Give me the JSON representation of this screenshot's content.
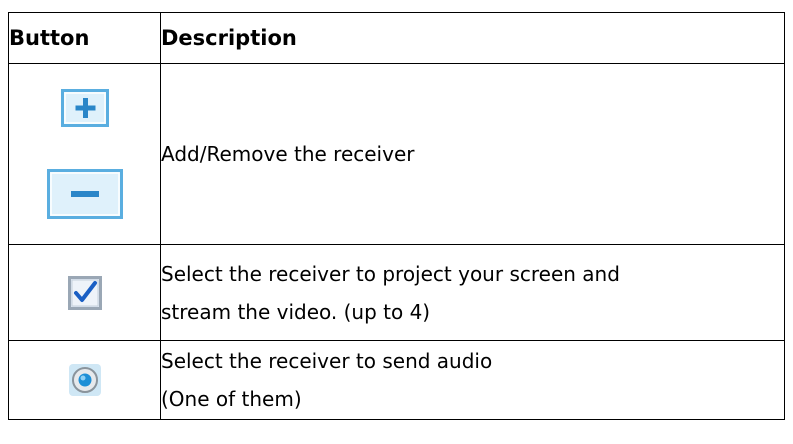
{
  "table": {
    "headers": [
      "Button",
      "Description"
    ],
    "rows": [
      {
        "icons": [
          "plus-button-icon",
          "minus-button-icon"
        ],
        "description": [
          "Add/Remove the receiver"
        ]
      },
      {
        "icons": [
          "checkbox-checked-icon"
        ],
        "description": [
          "Select the receiver to project your screen and",
          "stream the video. (up to 4)"
        ]
      },
      {
        "icons": [
          "radio-button-icon"
        ],
        "description": [
          "Select the receiver to send audio",
          "(One of them)"
        ]
      }
    ]
  },
  "colors": {
    "border": "#000000",
    "icon_fill": "#dff1fb",
    "icon_border": "#5aaee0",
    "icon_symbol": "#2a86c8",
    "check_mark": "#1a5fc4"
  }
}
